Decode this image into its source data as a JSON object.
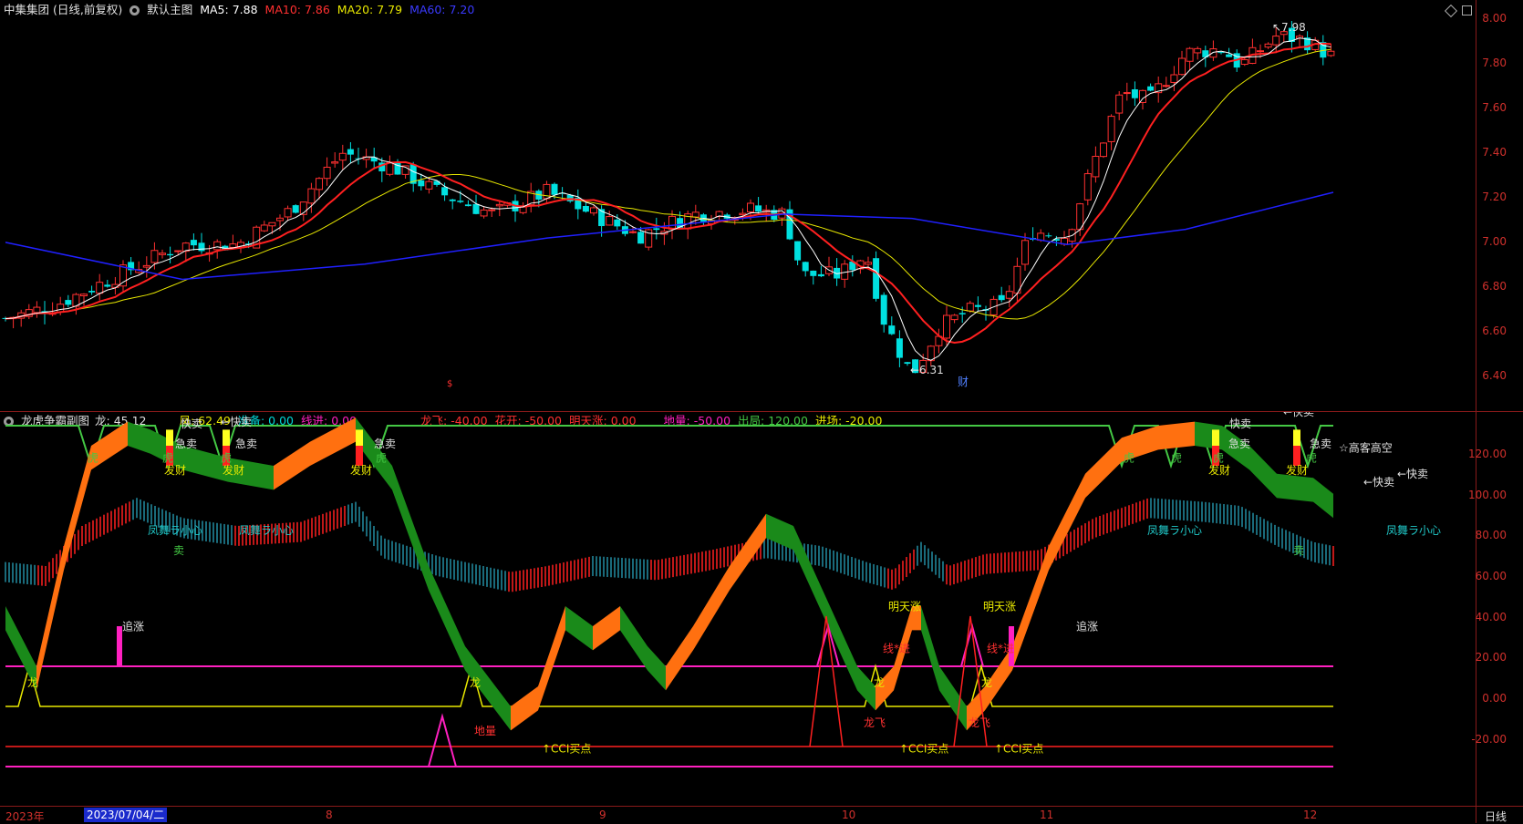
{
  "main_header": {
    "stock": "中集集团 (日线,前复权)",
    "template": "默认主图",
    "ma5": "MA5: 7.88",
    "ma10": "MA10: 7.86",
    "ma20": "MA20: 7.79",
    "ma60": "MA60: 7.20"
  },
  "sub_header": {
    "title": "龙虎争霸副图",
    "long": "龙: 45.12",
    "feng": "凤: 62.49",
    "zhunbei": "准备: 0.00",
    "xianjin": "线进: 0.00",
    "longfei": "龙飞: -40.00",
    "huakai": "花开: -50.00",
    "mingtianzhang": "明天涨: 0.00",
    "diliang": "地量: -50.00",
    "chuju": "出局: 120.00",
    "jinchang": "进场: -20.00"
  },
  "colors": {
    "bg": "#000000",
    "axis_red": "#d0302c",
    "ma5": "#ffffff",
    "ma10": "#ff2020",
    "ma20": "#e8e800",
    "ma60": "#2020ff",
    "bull": "#ff3030",
    "bear": "#00e0e0",
    "green_line": "#44c844",
    "magenta": "#ff20c0"
  },
  "price_axis": [
    "8.00",
    "7.80",
    "7.60",
    "7.40",
    "7.20",
    "7.00",
    "6.80",
    "6.60",
    "6.40"
  ],
  "osc_axis": [
    "120.00",
    "100.00",
    "80.00",
    "60.00",
    "40.00",
    "20.00",
    "0.00",
    "-20.00"
  ],
  "x_axis": {
    "year": "2023年",
    "cursor_date": "2023/07/04/二",
    "months": [
      "8",
      "9",
      "10",
      "11",
      "12"
    ],
    "right_label": "日线"
  },
  "price_annotations": {
    "high": "7.98",
    "low": "6.31",
    "cai": "财",
    "s_mark": "$"
  },
  "signals": {
    "fa_cai": "发财",
    "kuai_mai": "快卖",
    "left_kuai_mai": "←快卖",
    "fengwu": "凤舞ラ小心",
    "mai": "卖",
    "zhui_zhang": "追涨",
    "ming_tian_zhang": "明天涨",
    "long": "龙",
    "long_fei": "龙飞",
    "di_liang": "地量",
    "cci_buy": "↑CCI买点",
    "gao_gao": "☆高客高空",
    "xian_jin": "线*进",
    "hu": "虎",
    "ji_mai": "急卖"
  },
  "icons": {
    "collapse": "collapse-circle-icon",
    "diamond": "diamond-icon",
    "maximize": "maximize-square-icon"
  }
}
